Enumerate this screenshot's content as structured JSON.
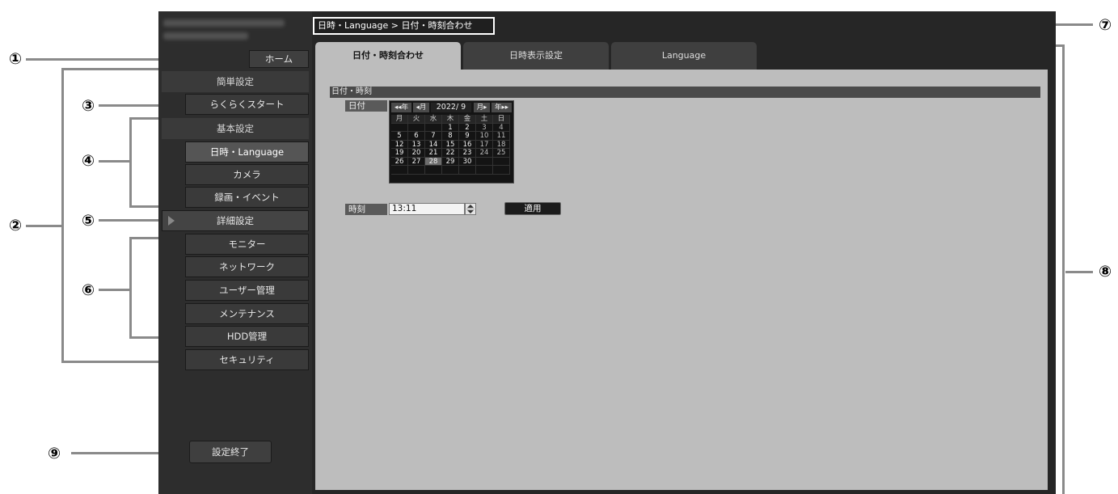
{
  "callouts": [
    "①",
    "②",
    "③",
    "④",
    "⑤",
    "⑥",
    "⑦",
    "⑧",
    "⑨"
  ],
  "breadcrumb": "日時・Language > 日付・時刻合わせ",
  "sidebar": {
    "home_button": "ホーム",
    "section_easy": "簡単設定",
    "easy_start_button": "らくらくスタート",
    "section_basic": "基本設定",
    "items": [
      {
        "label": "日時・Language",
        "selected": true
      },
      {
        "label": "カメラ",
        "selected": false
      },
      {
        "label": "録画・イベント",
        "selected": false
      },
      {
        "label": "詳細設定",
        "selected": false
      },
      {
        "label": "モニター",
        "selected": false
      },
      {
        "label": "ネットワーク",
        "selected": false
      },
      {
        "label": "ユーザー管理",
        "selected": false
      },
      {
        "label": "メンテナンス",
        "selected": false
      },
      {
        "label": "HDD管理",
        "selected": false
      },
      {
        "label": "セキュリティ",
        "selected": false
      }
    ],
    "exit_button": "設定終了"
  },
  "tabs": [
    {
      "label": "日付・時刻合わせ",
      "active": true
    },
    {
      "label": "日時表示設定",
      "active": false
    },
    {
      "label": "Language",
      "active": false
    }
  ],
  "content": {
    "section_title": "日付・時刻",
    "date_label": "日付",
    "calendar": {
      "prev_year": "◂◂年",
      "prev_month": "◂月",
      "year_month": "2022/ 9",
      "next_month": "月▸",
      "next_year": "年▸▸",
      "weekdays": [
        "月",
        "火",
        "水",
        "木",
        "金",
        "土",
        "日"
      ],
      "rows": [
        [
          "",
          "",
          "",
          "1",
          "2",
          "3",
          "4"
        ],
        [
          "5",
          "6",
          "7",
          "8",
          "9",
          "10",
          "11"
        ],
        [
          "12",
          "13",
          "14",
          "15",
          "16",
          "17",
          "18"
        ],
        [
          "19",
          "20",
          "21",
          "22",
          "23",
          "24",
          "25"
        ],
        [
          "26",
          "27",
          "28",
          "29",
          "30",
          "",
          ""
        ],
        [
          "",
          "",
          "",
          "",
          "",
          "",
          ""
        ]
      ],
      "selected_day": "28"
    },
    "time_label": "時刻",
    "time_value": "13:11",
    "apply_button": "適用"
  }
}
